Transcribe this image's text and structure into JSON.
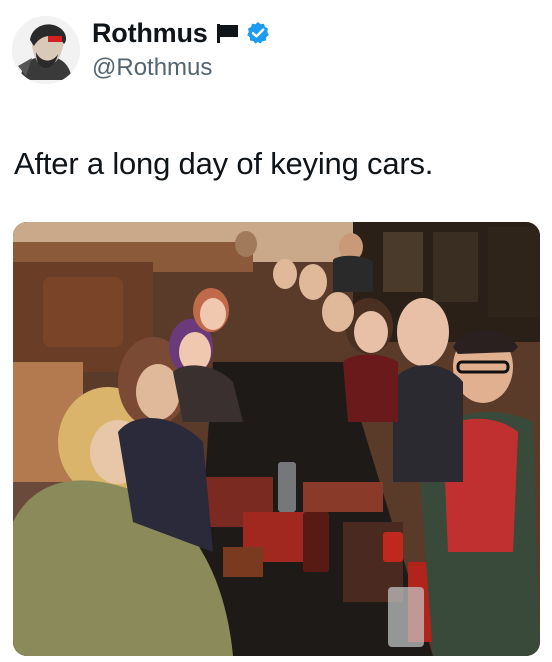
{
  "tweet": {
    "author": {
      "display_name": "Rothmus",
      "handle": "@Rothmus",
      "icons": [
        "black-flag-icon",
        "verified-badge-icon"
      ]
    },
    "text": "After a long day of keying cars.",
    "media": {
      "kind": "photo"
    },
    "colors": {
      "verified": "#1d9bf0",
      "handle": "#536471",
      "text": "#0f1419"
    }
  }
}
